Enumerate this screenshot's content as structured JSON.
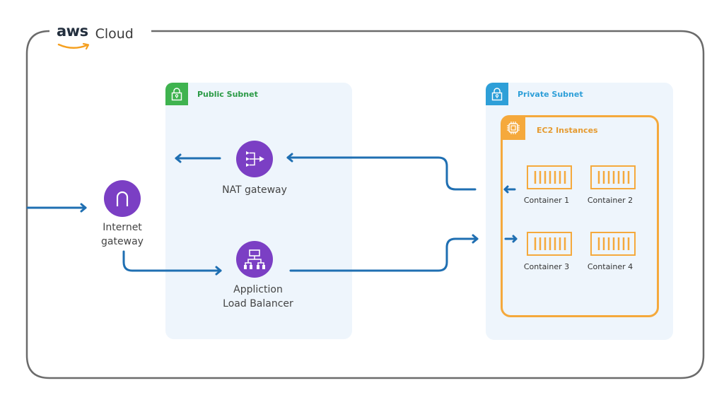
{
  "cloud": {
    "brand": "aws",
    "title": "Cloud",
    "colors": {
      "frame": "#6b6b6b",
      "aws_text": "#232f3e",
      "aws_smile": "#f5a020"
    }
  },
  "colors": {
    "arrow": "#1f6fb2",
    "node_fill": "#7b3fc4",
    "public_badge": "#3fb34f",
    "private_badge": "#2e9fd8",
    "ec2_accent": "#f5a93c",
    "subnet_bg": "#eef5fc"
  },
  "public_subnet": {
    "label": "Public Subnet",
    "icon": "lock-icon",
    "nodes": {
      "nat_gateway": {
        "label": "NAT gateway",
        "icon": "nat-gateway-icon"
      },
      "load_balancer": {
        "label_line1": "Appliction",
        "label_line2": "Load Balancer",
        "icon": "load-balancer-icon"
      }
    }
  },
  "internet_gateway": {
    "label_line1": "Internet",
    "label_line2": "gateway",
    "icon": "internet-gateway-icon"
  },
  "private_subnet": {
    "label": "Private Subnet",
    "icon": "lock-icon",
    "ec2": {
      "label": "EC2 Instances",
      "icon": "chip-icon",
      "containers": [
        {
          "label": "Container 1"
        },
        {
          "label": "Container 2"
        },
        {
          "label": "Container 3"
        },
        {
          "label": "Container 4"
        }
      ]
    }
  },
  "connections": [
    {
      "from": "outside",
      "to": "internet-gateway"
    },
    {
      "from": "internet-gateway",
      "to": "load-balancer"
    },
    {
      "from": "load-balancer",
      "to": "ec2-instances"
    },
    {
      "from": "ec2-instances",
      "to": "nat-gateway"
    },
    {
      "from": "nat-gateway",
      "to": "outside"
    }
  ]
}
